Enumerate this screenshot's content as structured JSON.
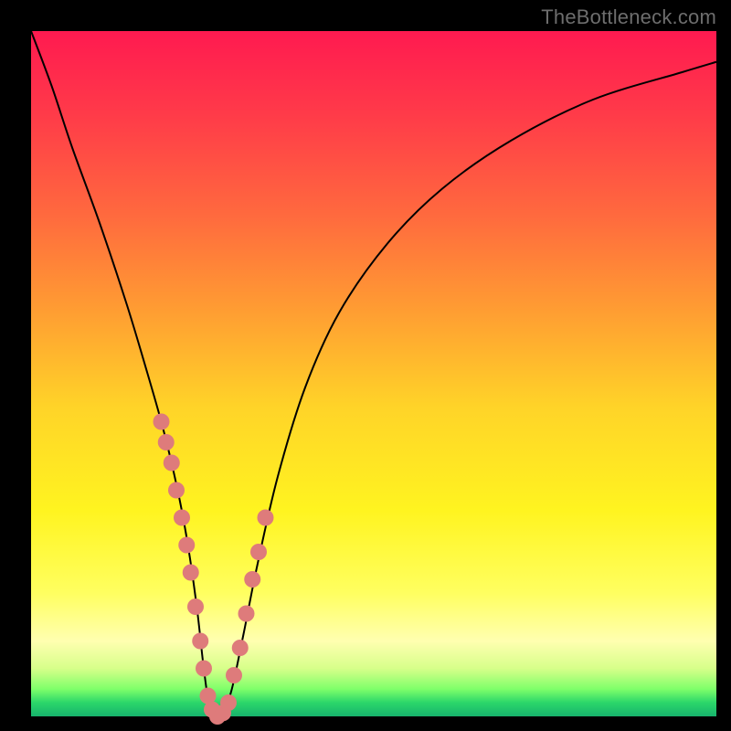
{
  "watermark": "TheBottleneck.com",
  "chart_data": {
    "type": "line",
    "title": "",
    "xlabel": "",
    "ylabel": "",
    "xlim": [
      0,
      100
    ],
    "ylim": [
      0,
      100
    ],
    "grid": false,
    "legend": false,
    "series": [
      {
        "name": "bottleneck-curve",
        "x": [
          0,
          3,
          6,
          10,
          14,
          17,
          19,
          20.5,
          22,
          23.2,
          24.3,
          25.2,
          26.1,
          27,
          28,
          29.3,
          31,
          33,
          36,
          40,
          45,
          52,
          60,
          70,
          82,
          95,
          100
        ],
        "y": [
          100,
          92,
          83,
          72,
          60,
          50,
          43,
          37,
          30,
          23,
          15,
          7,
          1,
          0,
          0.5,
          4,
          12,
          22,
          35,
          48,
          59,
          69,
          77,
          84,
          90,
          94,
          95.5
        ]
      }
    ],
    "markers": {
      "name": "highlight-points",
      "color": "#de7b7b",
      "x": [
        19.0,
        19.7,
        20.5,
        21.2,
        22.0,
        22.7,
        23.3,
        24.0,
        24.7,
        25.2,
        25.8,
        26.4,
        27.2,
        28.0,
        28.8,
        29.6,
        30.5,
        31.4,
        32.3,
        33.2,
        34.2
      ],
      "y": [
        43,
        40,
        37,
        33,
        29,
        25,
        21,
        16,
        11,
        7,
        3,
        1,
        0,
        0.5,
        2,
        6,
        10,
        15,
        20,
        24,
        29
      ]
    }
  }
}
